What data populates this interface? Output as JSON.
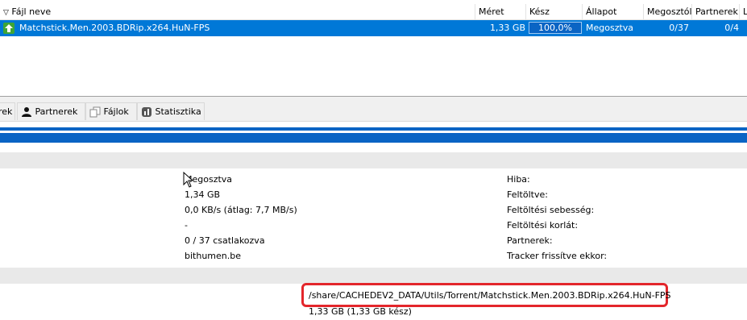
{
  "torrent_list": {
    "columns": [
      {
        "id": "name",
        "label": "Fájl neve"
      },
      {
        "id": "size",
        "label": "Méret"
      },
      {
        "id": "done",
        "label": "Kész"
      },
      {
        "id": "status",
        "label": "Állapot"
      },
      {
        "id": "seeds",
        "label": "Megosztól"
      },
      {
        "id": "peers",
        "label": "Partnerek"
      },
      {
        "id": "ls",
        "label": "L"
      }
    ],
    "rows": [
      {
        "name": "Matchstick.Men.2003.BDRip.x264.HuN-FPS",
        "size": "1,33 GB",
        "progress_label": "100,0%",
        "progress": 1.0,
        "status": "Megosztva",
        "seeds": "0/37",
        "peers": "0/4"
      }
    ]
  },
  "tabs": [
    {
      "label": "rek"
    },
    {
      "label": "Partnerek"
    },
    {
      "label": "Fájlok"
    },
    {
      "label": "Statisztika"
    }
  ],
  "transfer": {
    "status": "Megosztva",
    "size": "1,34 GB",
    "speed": "0,0 KB/s (átlag: 7,7 MB/s)",
    "dash": "-",
    "connected": "0 / 37 csatlakozva",
    "tracker": "bithumen.be"
  },
  "upload_labels": {
    "error": "Hiba:",
    "uploaded": "Feltöltve:",
    "upload_speed": "Feltöltési sebesség:",
    "upload_limit": "Feltöltési korlát:",
    "peers": "Partnerek:",
    "tracker_updated": "Tracker frissítve ekkor:"
  },
  "info": {
    "save_path": "/share/CACHEDEV2_DATA/Utils/Torrent/Matchstick.Men.2003.BDRip.x264.HuN-FPS",
    "total_size": "1,33 GB (1,33 GB kész)"
  },
  "colors": {
    "selection": "#0078d7",
    "progress": "#0a64c4",
    "highlight_box": "#e3262b"
  }
}
